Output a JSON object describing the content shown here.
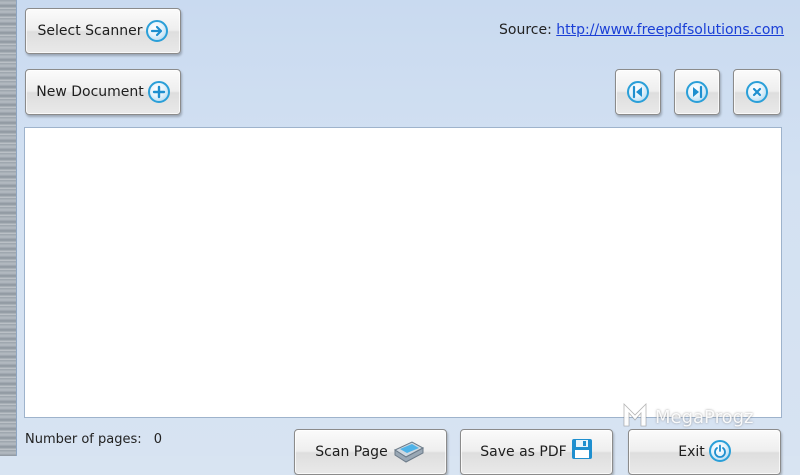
{
  "toolbar": {
    "select_scanner_label": "Select Scanner",
    "new_document_label": "New Document"
  },
  "source": {
    "label": "Source:",
    "url": "http://www.freepdfsolutions.com"
  },
  "navigation": {
    "first_icon": "skip-first-icon",
    "last_icon": "skip-last-icon",
    "delete_icon": "close-icon"
  },
  "status": {
    "pages_label": "Number of pages:",
    "pages_value": "0"
  },
  "actions": {
    "scan_label": "Scan Page",
    "save_label": "Save as PDF",
    "exit_label": "Exit"
  },
  "watermark": {
    "text": "MegaProgz"
  },
  "colors": {
    "accent": "#2a9fd8",
    "link": "#1a3fd6"
  }
}
